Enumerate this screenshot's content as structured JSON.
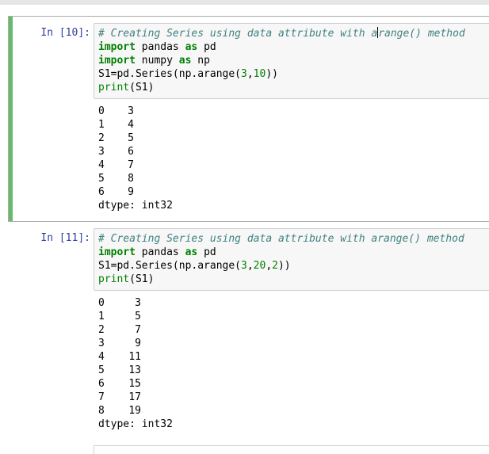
{
  "cells": [
    {
      "prompt": "In [10]:",
      "selected": true,
      "code": {
        "comment": "# Creating Series using data attribute with arange() method",
        "comment_before_cursor": "# Creating Series using data attribute with a",
        "comment_after_cursor": "range() method",
        "line2_kw1": "import",
        "line2_mod": " pandas ",
        "line2_kw2": "as",
        "line2_alias": " pd",
        "line3_kw1": "import",
        "line3_mod": " numpy ",
        "line3_kw2": "as",
        "line3_alias": " np",
        "line4_a": "S1=pd.Series(np.arange(",
        "line4_n1": "3",
        "line4_c": ",",
        "line4_n2": "10",
        "line4_e": "))",
        "line5_f": "print",
        "line5_e": "(S1)"
      },
      "output": {
        "rows": [
          {
            "idx": "0",
            "val": "3"
          },
          {
            "idx": "1",
            "val": "4"
          },
          {
            "idx": "2",
            "val": "5"
          },
          {
            "idx": "3",
            "val": "6"
          },
          {
            "idx": "4",
            "val": "7"
          },
          {
            "idx": "5",
            "val": "8"
          },
          {
            "idx": "6",
            "val": "9"
          }
        ],
        "dtype": "dtype: int32"
      }
    },
    {
      "prompt": "In [11]:",
      "selected": false,
      "code": {
        "comment": "# Creating Series using data attribute with arange() method",
        "line2_kw1": "import",
        "line2_mod": " pandas ",
        "line2_kw2": "as",
        "line2_alias": " pd",
        "line3_a": "S1=pd.Series(np.arange(",
        "line3_n1": "3",
        "line3_c1": ",",
        "line3_n2": "20",
        "line3_c2": ",",
        "line3_n3": "2",
        "line3_e": "))",
        "line4_f": "print",
        "line4_e": "(S1)"
      },
      "output": {
        "rows": [
          {
            "idx": "0",
            "val": "3"
          },
          {
            "idx": "1",
            "val": "5"
          },
          {
            "idx": "2",
            "val": "7"
          },
          {
            "idx": "3",
            "val": "9"
          },
          {
            "idx": "4",
            "val": "11"
          },
          {
            "idx": "5",
            "val": "13"
          },
          {
            "idx": "6",
            "val": "15"
          },
          {
            "idx": "7",
            "val": "17"
          },
          {
            "idx": "8",
            "val": "19"
          }
        ],
        "dtype": "dtype: int32"
      }
    }
  ],
  "colors": {
    "prompt": "#303f9f",
    "selected_bar": "#66bb6a",
    "input_bg": "#f7f7f7",
    "comment": "#408080",
    "keyword": "#008000"
  }
}
